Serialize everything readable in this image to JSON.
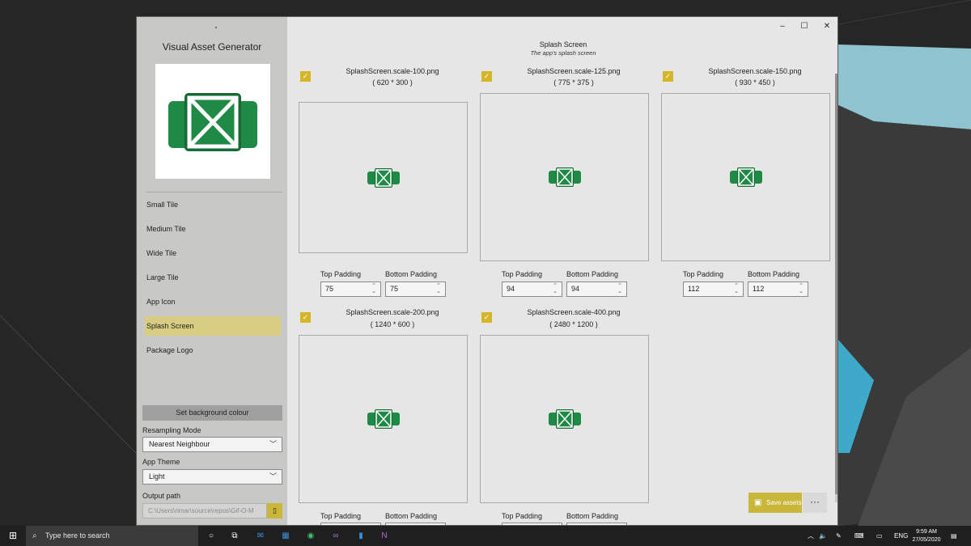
{
  "window": {
    "app_title": "Visual Asset Generator",
    "minimize": "–",
    "maximize": "☐",
    "close": "✕"
  },
  "sidebar": {
    "items": [
      {
        "label": "Small Tile"
      },
      {
        "label": "Medium Tile"
      },
      {
        "label": "Wide Tile"
      },
      {
        "label": "Large Tile"
      },
      {
        "label": "App Icon"
      },
      {
        "label": "Splash Screen",
        "active": true
      },
      {
        "label": "Package Logo"
      }
    ],
    "set_background_label": "Set background colour",
    "resampling_label": "Resampling Mode",
    "resampling_value": "Nearest Neighbour",
    "theme_label": "App Theme",
    "theme_value": "Light",
    "output_label": "Output path",
    "output_value": "C:\\Users\\rimar\\source\\repos\\Gif-O-M",
    "accent": "#d8cc83"
  },
  "main": {
    "title": "Splash Screen",
    "subtitle": "The app's splash screen",
    "assets": [
      {
        "name": "SplashScreen.scale-100.png",
        "dims": "( 620 * 300 )",
        "top_padding": "75",
        "bottom_padding": "75",
        "checked": true
      },
      {
        "name": "SplashScreen.scale-125.png",
        "dims": "( 775 * 375 )",
        "top_padding": "94",
        "bottom_padding": "94",
        "checked": true
      },
      {
        "name": "SplashScreen.scale-150.png",
        "dims": "( 930 * 450 )",
        "top_padding": "112",
        "bottom_padding": "112",
        "checked": true
      },
      {
        "name": "SplashScreen.scale-200.png",
        "dims": "( 1240 * 600 )",
        "top_padding": "",
        "bottom_padding": "",
        "checked": true
      },
      {
        "name": "SplashScreen.scale-400.png",
        "dims": "( 2480 * 1200 )",
        "top_padding": "",
        "bottom_padding": "",
        "checked": true
      }
    ],
    "top_padding_label": "Top Padding",
    "bottom_padding_label": "Bottom Padding",
    "save_label": "Save assets",
    "more_label": "···"
  },
  "taskbar": {
    "search_placeholder": "Type here to search",
    "language": "ENG",
    "time": "9:59 AM",
    "date": "27/05/2020"
  },
  "colors": {
    "checkbox": "#d4b628",
    "save_button": "#c9b73a",
    "logo_green": "#1e8a45"
  }
}
